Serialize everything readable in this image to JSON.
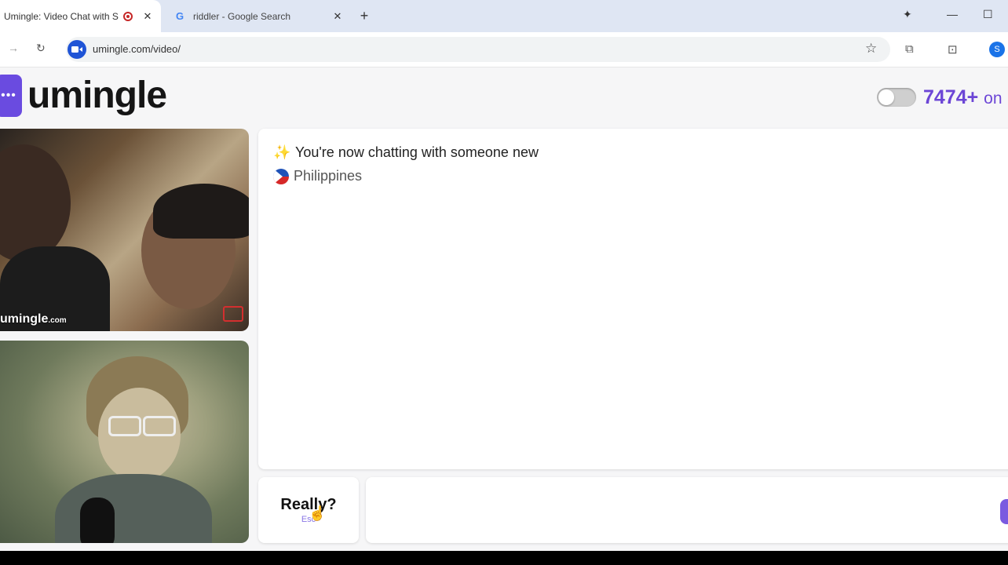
{
  "browser": {
    "tabs": [
      {
        "title": "Umingle: Video Chat with St",
        "active": true
      },
      {
        "title": "riddler - Google Search",
        "active": false
      }
    ],
    "url": "umingle.com/video/",
    "profile_initial": "S"
  },
  "site": {
    "logo_text": "umingle",
    "online_count": "7474+",
    "online_suffix": "on",
    "brand_color": "#6c46d6"
  },
  "video": {
    "watermark": "umingle",
    "watermark_suffix": ".com"
  },
  "chat": {
    "status_message": "You're now chatting with someone new",
    "country": "Philippines"
  },
  "controls": {
    "esc_label": "Really?",
    "esc_key": "Esc"
  }
}
